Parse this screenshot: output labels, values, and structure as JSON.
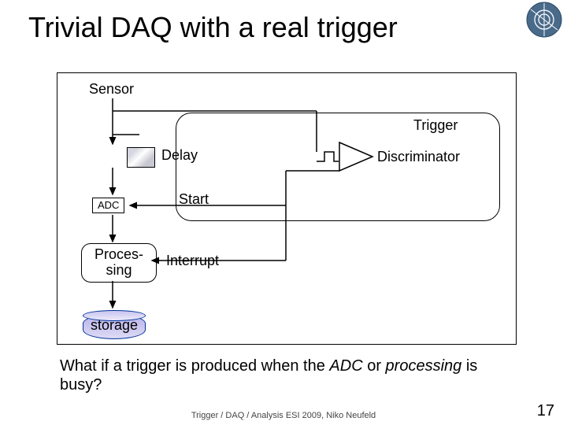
{
  "title": "Trivial DAQ with a real trigger",
  "diagram": {
    "sensor": "Sensor",
    "trigger": "Trigger",
    "delay": "Delay",
    "discriminator": "Discriminator",
    "adc": "ADC",
    "start": "Start",
    "processing": "Proces-\nsing",
    "interrupt": "Interrupt",
    "storage": "storage"
  },
  "question_parts": {
    "p1": "What if a trigger is produced when the ",
    "p2": "ADC",
    "p3": " or ",
    "p4": "processing",
    "p5": " is busy?"
  },
  "footer": "Trigger / DAQ / Analysis  ESI 2009, Niko Neufeld",
  "page_number": "17",
  "chart_data": {
    "type": "table",
    "description": "Block diagram of a trivial DAQ chain with a real trigger",
    "nodes": [
      {
        "id": "sensor",
        "label": "Sensor"
      },
      {
        "id": "delay",
        "label": "Delay"
      },
      {
        "id": "adc",
        "label": "ADC"
      },
      {
        "id": "processing",
        "label": "Processing"
      },
      {
        "id": "storage",
        "label": "storage"
      },
      {
        "id": "trigger_group",
        "label": "Trigger"
      },
      {
        "id": "discriminator",
        "label": "Discriminator"
      }
    ],
    "edges": [
      {
        "from": "sensor",
        "to": "delay"
      },
      {
        "from": "sensor",
        "to": "discriminator"
      },
      {
        "from": "delay",
        "to": "adc"
      },
      {
        "from": "discriminator",
        "to": "adc",
        "label": "Start"
      },
      {
        "from": "discriminator",
        "to": "processing",
        "label": "Interrupt"
      },
      {
        "from": "adc",
        "to": "processing"
      },
      {
        "from": "processing",
        "to": "storage"
      }
    ]
  }
}
